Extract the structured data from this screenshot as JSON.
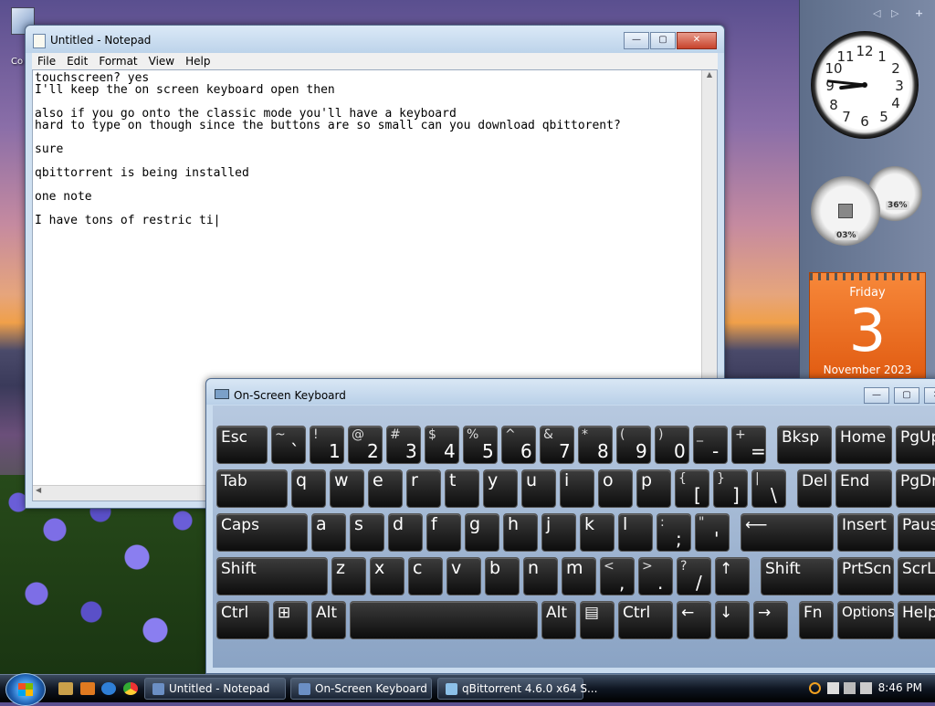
{
  "desktop": {
    "icon_label": "Co"
  },
  "notepad": {
    "title": "Untitled - Notepad",
    "menu": [
      "File",
      "Edit",
      "Format",
      "View",
      "Help"
    ],
    "content": "touchscreen? yes\nI'll keep the on screen keyboard open then\n\nalso if you go onto the classic mode you'll have a keyboard\nhard to type on though since the buttons are so small can you download qbittorent?\n\nsure\n\nqbittorrent is being installed\n\none note\n\nI have tons of restric ti|"
  },
  "osk": {
    "title": "On-Screen Keyboard",
    "rows": [
      [
        {
          "label": "Esc",
          "w": 56
        },
        {
          "shift": "~",
          "main": "`",
          "w": 38
        },
        {
          "shift": "!",
          "main": "1",
          "w": 38
        },
        {
          "shift": "@",
          "main": "2",
          "w": 38
        },
        {
          "shift": "#",
          "main": "3",
          "w": 38
        },
        {
          "shift": "$",
          "main": "4",
          "w": 38
        },
        {
          "shift": "%",
          "main": "5",
          "w": 38
        },
        {
          "shift": "^",
          "main": "6",
          "w": 38
        },
        {
          "shift": "&",
          "main": "7",
          "w": 38
        },
        {
          "shift": "*",
          "main": "8",
          "w": 38
        },
        {
          "shift": "(",
          "main": "9",
          "w": 38
        },
        {
          "shift": ")",
          "main": "0",
          "w": 38
        },
        {
          "shift": "_",
          "main": "-",
          "w": 38
        },
        {
          "shift": "+",
          "main": "=",
          "w": 38
        },
        {
          "label": "Bksp",
          "w": 60,
          "gap": 8
        },
        {
          "label": "Home",
          "w": 62
        },
        {
          "label": "PgUp",
          "w": 62
        }
      ],
      [
        {
          "label": "Tab",
          "w": 78
        },
        {
          "main1": "q",
          "w": 38
        },
        {
          "main1": "w",
          "w": 38
        },
        {
          "main1": "e",
          "w": 38
        },
        {
          "main1": "r",
          "w": 38
        },
        {
          "main1": "t",
          "w": 38
        },
        {
          "main1": "y",
          "w": 38
        },
        {
          "main1": "u",
          "w": 38
        },
        {
          "main1": "i",
          "w": 38
        },
        {
          "main1": "o",
          "w": 38
        },
        {
          "main1": "p",
          "w": 38
        },
        {
          "shift": "{",
          "main": "[",
          "w": 38
        },
        {
          "shift": "}",
          "main": "]",
          "w": 38
        },
        {
          "shift": "|",
          "main": "\\",
          "w": 38
        },
        {
          "label": "Del",
          "w": 38,
          "gap": 8
        },
        {
          "label": "End",
          "w": 62
        },
        {
          "label": "PgDn",
          "w": 62
        }
      ],
      [
        {
          "label": "Caps",
          "w": 100
        },
        {
          "main1": "a",
          "w": 38
        },
        {
          "main1": "s",
          "w": 38
        },
        {
          "main1": "d",
          "w": 38
        },
        {
          "main1": "f",
          "w": 38
        },
        {
          "main1": "g",
          "w": 38
        },
        {
          "main1": "h",
          "w": 38
        },
        {
          "main1": "j",
          "w": 38
        },
        {
          "main1": "k",
          "w": 38
        },
        {
          "main1": "l",
          "w": 38
        },
        {
          "shift": ":",
          "main": ";",
          "w": 38
        },
        {
          "shift": "\"",
          "main": "'",
          "w": 38
        },
        {
          "label": "⟵",
          "w": 102,
          "gap": 8
        },
        {
          "label": "Insert",
          "w": 62
        },
        {
          "label": "Pause",
          "w": 62
        }
      ],
      [
        {
          "label": "Shift",
          "w": 122
        },
        {
          "main1": "z",
          "w": 38
        },
        {
          "main1": "x",
          "w": 38
        },
        {
          "main1": "c",
          "w": 38
        },
        {
          "main1": "v",
          "w": 38
        },
        {
          "main1": "b",
          "w": 38
        },
        {
          "main1": "n",
          "w": 38
        },
        {
          "main1": "m",
          "w": 38
        },
        {
          "shift": "<",
          "main": ",",
          "w": 38
        },
        {
          "shift": ">",
          "main": ".",
          "w": 38
        },
        {
          "shift": "?",
          "main": "/",
          "w": 38
        },
        {
          "label": "↑",
          "w": 38
        },
        {
          "label": "Shift",
          "w": 80,
          "gap": 8
        },
        {
          "label": "PrtScn",
          "w": 62
        },
        {
          "label": "ScrLk",
          "w": 62
        }
      ],
      [
        {
          "label": "Ctrl",
          "w": 58
        },
        {
          "label": "⊞",
          "w": 38
        },
        {
          "label": "Alt",
          "w": 38
        },
        {
          "label": "",
          "w": 206
        },
        {
          "label": "Alt",
          "w": 38
        },
        {
          "label": "▤",
          "w": 38
        },
        {
          "label": "Ctrl",
          "w": 60
        },
        {
          "label": "←",
          "w": 38
        },
        {
          "label": "↓",
          "w": 38
        },
        {
          "label": "→",
          "w": 38
        },
        {
          "label": "Fn",
          "w": 38,
          "gap": 8
        },
        {
          "label": "Options",
          "w": 62,
          "small": true
        },
        {
          "label": "Help",
          "w": 62
        }
      ]
    ]
  },
  "calendar": {
    "weekday": "Friday",
    "date": "3",
    "month": "November 2023"
  },
  "gauges": {
    "cpu": "03%",
    "ram": "36%"
  },
  "clock": {
    "hour": 8,
    "minute": 46
  },
  "taskbar": {
    "buttons": [
      {
        "label": "Untitled - Notepad",
        "color": "#6b8fc4"
      },
      {
        "label": "On-Screen Keyboard",
        "color": "#6b8fc4"
      },
      {
        "label": "qBittorrent 4.6.0 x64 S...",
        "color": "#8cc0e8"
      }
    ],
    "time": "8:46 PM"
  }
}
